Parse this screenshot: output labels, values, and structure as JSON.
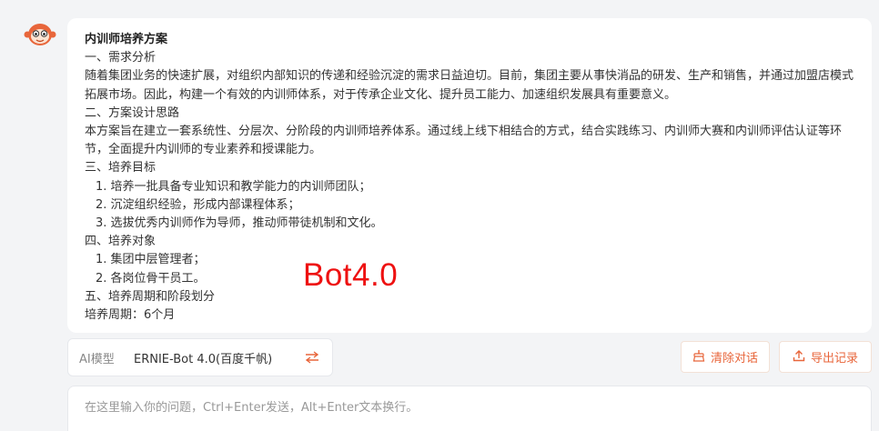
{
  "message": {
    "title": "内训师培养方案",
    "lines": [
      "一、需求分析",
      "随着集团业务的快速扩展，对组织内部知识的传递和经验沉淀的需求日益迫切。目前，集团主要从事快消品的研发、生产和销售，并通过加盟店模式拓展市场。因此，构建一个有效的内训师体系，对于传承企业文化、提升员工能力、加速组织发展具有重要意义。",
      "二、方案设计思路",
      "本方案旨在建立一套系统性、分层次、分阶段的内训师培养体系。通过线上线下相结合的方式，结合实践练习、内训师大赛和内训师评估认证等环节，全面提升内训师的专业素养和授课能力。",
      "三、培养目标",
      "1. 培养一批具备专业知识和教学能力的内训师团队；",
      "2. 沉淀组织经验，形成内部课程体系；",
      "3. 选拔优秀内训师作为导师，推动师带徒机制和文化。",
      "四、培养对象",
      "1. 集团中层管理者；",
      "2. 各岗位骨干员工。",
      "五、培养周期和阶段划分",
      "培养周期：6个月"
    ]
  },
  "watermark": "Bot4.0",
  "model_selector": {
    "label": "AI模型",
    "value": "ERNIE-Bot 4.0(百度千帆)"
  },
  "actions": {
    "clear": "清除对话",
    "export": "导出记录"
  },
  "input": {
    "placeholder": "在这里输入你的问题，Ctrl+Enter发送，Alt+Enter文本换行。"
  },
  "icons": {
    "avatar": "monkey-avatar-icon",
    "swap": "swap-arrows-icon",
    "clear": "broom-icon",
    "export": "upload-icon"
  },
  "colors": {
    "accent": "#e8663b",
    "watermark": "#ee1111"
  }
}
